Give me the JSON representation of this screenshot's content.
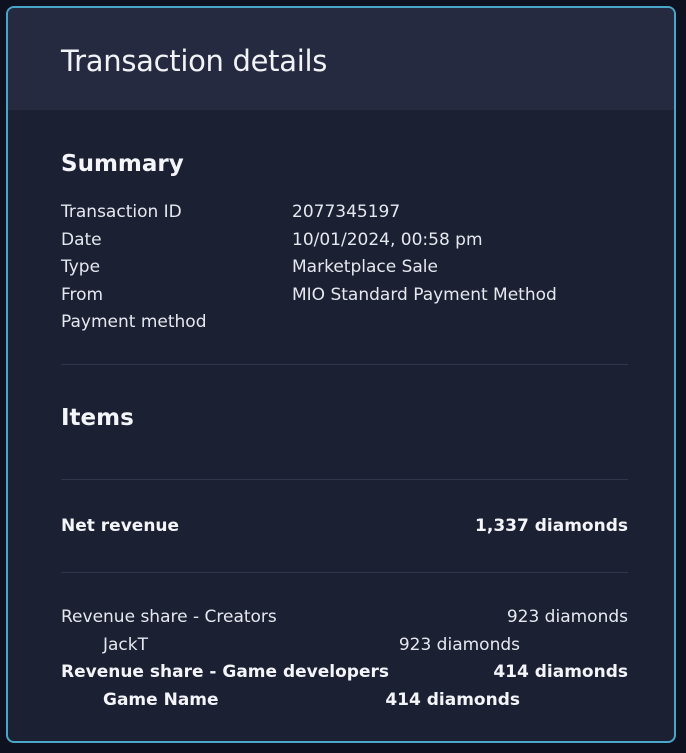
{
  "dialog": {
    "title": "Transaction details"
  },
  "summary": {
    "heading": "Summary",
    "rows": [
      {
        "label": "Transaction ID",
        "value": "2077345197"
      },
      {
        "label": "Date",
        "value": "10/01/2024, 00:58 pm"
      },
      {
        "label": "Type",
        "value": "Marketplace Sale"
      },
      {
        "label": "From",
        "value": "MIO Standard Payment Method"
      },
      {
        "label": "Payment method",
        "value": ""
      }
    ]
  },
  "items": {
    "heading": "Items",
    "net_revenue": {
      "label": "Net revenue",
      "value": "1,337 diamonds"
    },
    "shares": [
      {
        "label": "Revenue share - Creators",
        "value": "923 diamonds"
      },
      {
        "label": "JackT",
        "value": "923 diamonds"
      },
      {
        "label": "Revenue share - Game developers",
        "value": "414 diamonds"
      },
      {
        "label": "Game Name",
        "value": "414 diamonds"
      }
    ]
  },
  "colors": {
    "border_accent": "#4aa6c8",
    "panel_bg": "#1c2033",
    "header_bg": "#252a40"
  }
}
